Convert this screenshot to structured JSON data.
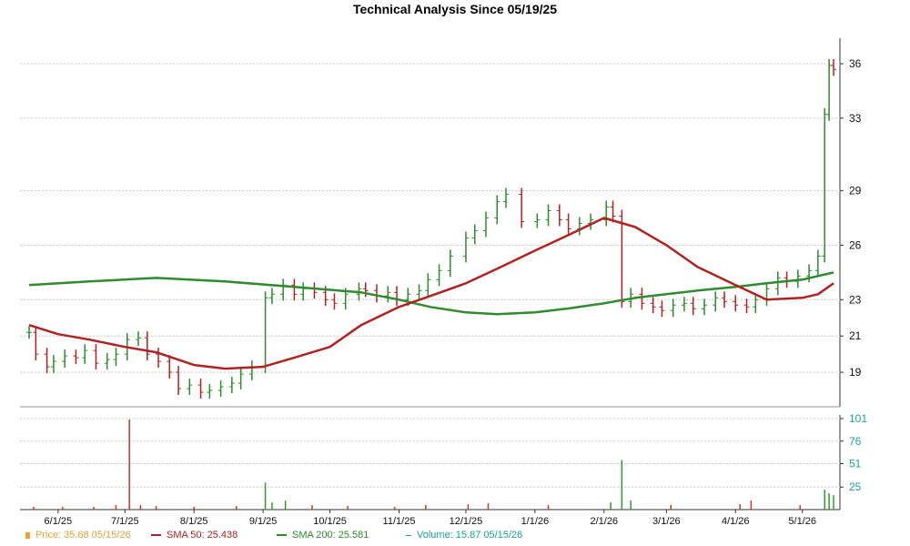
{
  "chart_data": {
    "type": "line",
    "title": "Technical Analysis Since 05/19/25",
    "price_axis": {
      "ticks": [
        19,
        21,
        23,
        26,
        29,
        33,
        36
      ],
      "ylim": [
        17.2,
        37.0
      ]
    },
    "volume_axis": {
      "ticks": [
        25,
        51,
        76,
        101
      ],
      "ylim": [
        0,
        101
      ]
    },
    "x_labels": [
      "6/1/25",
      "7/1/25",
      "8/1/25",
      "9/1/25",
      "10/1/25",
      "11/1/25",
      "12/1/25",
      "1/1/26",
      "2/1/26",
      "3/1/26",
      "4/1/26",
      "5/1/26"
    ],
    "x_label_dates": [
      "2025-06-01",
      "2025-07-01",
      "2025-08-01",
      "2025-09-01",
      "2025-10-01",
      "2025-11-01",
      "2025-12-01",
      "2026-01-01",
      "2026-02-01",
      "2026-03-01",
      "2026-04-01",
      "2026-05-01"
    ],
    "x_range": [
      "2025-05-19",
      "2026-05-15"
    ],
    "grid": true,
    "series": [
      {
        "name": "Price",
        "color": "#e8a33a",
        "values": [
          [
            "2025-05-19",
            21.2
          ],
          [
            "2025-05-22",
            20.0
          ],
          [
            "2025-05-27",
            19.3
          ],
          [
            "2025-05-30",
            19.6
          ],
          [
            "2025-06-04",
            19.9
          ],
          [
            "2025-06-09",
            19.8
          ],
          [
            "2025-06-13",
            20.2
          ],
          [
            "2025-06-18",
            19.5
          ],
          [
            "2025-06-23",
            19.7
          ],
          [
            "2025-06-27",
            20.0
          ],
          [
            "2025-07-02",
            20.8
          ],
          [
            "2025-07-07",
            20.9
          ],
          [
            "2025-07-11",
            20.0
          ],
          [
            "2025-07-16",
            19.6
          ],
          [
            "2025-07-21",
            19.0
          ],
          [
            "2025-07-25",
            18.1
          ],
          [
            "2025-07-30",
            18.3
          ],
          [
            "2025-08-04",
            17.9
          ],
          [
            "2025-08-08",
            18.0
          ],
          [
            "2025-08-13",
            18.2
          ],
          [
            "2025-08-18",
            18.4
          ],
          [
            "2025-08-22",
            18.9
          ],
          [
            "2025-08-27",
            19.3
          ],
          [
            "2025-09-02",
            23.1
          ],
          [
            "2025-09-05",
            23.3
          ],
          [
            "2025-09-10",
            23.8
          ],
          [
            "2025-09-15",
            23.3
          ],
          [
            "2025-09-19",
            23.6
          ],
          [
            "2025-09-24",
            23.4
          ],
          [
            "2025-09-29",
            23.0
          ],
          [
            "2025-10-03",
            22.8
          ],
          [
            "2025-10-08",
            23.3
          ],
          [
            "2025-10-14",
            23.6
          ],
          [
            "2025-10-17",
            23.5
          ],
          [
            "2025-10-22",
            23.2
          ],
          [
            "2025-10-27",
            23.4
          ],
          [
            "2025-10-31",
            23.0
          ],
          [
            "2025-11-05",
            23.3
          ],
          [
            "2025-11-10",
            23.5
          ],
          [
            "2025-11-14",
            24.1
          ],
          [
            "2025-11-19",
            24.6
          ],
          [
            "2025-11-24",
            25.4
          ],
          [
            "2025-12-01",
            26.4
          ],
          [
            "2025-12-05",
            26.8
          ],
          [
            "2025-12-10",
            27.5
          ],
          [
            "2025-12-15",
            28.4
          ],
          [
            "2025-12-19",
            28.8
          ],
          [
            "2025-12-26",
            27.3
          ],
          [
            "2026-01-02",
            27.4
          ],
          [
            "2026-01-07",
            27.9
          ],
          [
            "2026-01-12",
            27.4
          ],
          [
            "2026-01-16",
            26.9
          ],
          [
            "2026-01-21",
            27.2
          ],
          [
            "2026-01-26",
            27.4
          ],
          [
            "2026-02-02",
            28.1
          ],
          [
            "2026-02-05",
            27.6
          ],
          [
            "2026-02-09",
            22.9
          ],
          [
            "2026-02-13",
            23.3
          ],
          [
            "2026-02-18",
            22.8
          ],
          [
            "2026-02-23",
            22.6
          ],
          [
            "2026-02-27",
            22.4
          ],
          [
            "2026-03-04",
            22.7
          ],
          [
            "2026-03-09",
            22.8
          ],
          [
            "2026-03-13",
            22.5
          ],
          [
            "2026-03-18",
            22.7
          ],
          [
            "2026-03-23",
            23.1
          ],
          [
            "2026-03-27",
            22.9
          ],
          [
            "2026-04-01",
            22.7
          ],
          [
            "2026-04-06",
            22.6
          ],
          [
            "2026-04-10",
            23.0
          ],
          [
            "2026-04-15",
            23.6
          ],
          [
            "2026-04-20",
            24.2
          ],
          [
            "2026-04-24",
            24.0
          ],
          [
            "2026-04-29",
            24.3
          ],
          [
            "2026-05-04",
            24.6
          ],
          [
            "2026-05-08",
            25.4
          ],
          [
            "2026-05-11",
            33.2
          ],
          [
            "2026-05-13",
            35.9
          ],
          [
            "2026-05-15",
            35.68
          ]
        ]
      },
      {
        "name": "SMA 50",
        "color": "#b22222",
        "values": [
          [
            "2025-05-19",
            21.6
          ],
          [
            "2025-06-01",
            21.1
          ],
          [
            "2025-06-15",
            20.8
          ],
          [
            "2025-07-01",
            20.4
          ],
          [
            "2025-07-15",
            20.1
          ],
          [
            "2025-08-01",
            19.4
          ],
          [
            "2025-08-15",
            19.2
          ],
          [
            "2025-09-01",
            19.3
          ],
          [
            "2025-09-15",
            19.8
          ],
          [
            "2025-10-01",
            20.4
          ],
          [
            "2025-10-15",
            21.6
          ],
          [
            "2025-11-01",
            22.6
          ],
          [
            "2025-11-15",
            23.2
          ],
          [
            "2025-12-01",
            23.9
          ],
          [
            "2025-12-15",
            24.7
          ],
          [
            "2026-01-01",
            25.7
          ],
          [
            "2026-01-15",
            26.5
          ],
          [
            "2026-02-01",
            27.5
          ],
          [
            "2026-02-15",
            27.0
          ],
          [
            "2026-03-01",
            26.0
          ],
          [
            "2026-03-15",
            24.8
          ],
          [
            "2026-04-01",
            23.8
          ],
          [
            "2026-04-15",
            23.0
          ],
          [
            "2026-05-01",
            23.1
          ],
          [
            "2026-05-08",
            23.3
          ],
          [
            "2026-05-15",
            23.9
          ]
        ]
      },
      {
        "name": "SMA 200",
        "color": "#2e8b2e",
        "values": [
          [
            "2025-05-19",
            23.8
          ],
          [
            "2025-06-15",
            24.0
          ],
          [
            "2025-07-15",
            24.2
          ],
          [
            "2025-08-15",
            24.0
          ],
          [
            "2025-09-15",
            23.7
          ],
          [
            "2025-10-15",
            23.4
          ],
          [
            "2025-11-01",
            23.0
          ],
          [
            "2025-11-15",
            22.6
          ],
          [
            "2025-12-01",
            22.3
          ],
          [
            "2025-12-15",
            22.2
          ],
          [
            "2026-01-01",
            22.3
          ],
          [
            "2026-01-15",
            22.5
          ],
          [
            "2026-02-01",
            22.8
          ],
          [
            "2026-02-15",
            23.1
          ],
          [
            "2026-03-01",
            23.3
          ],
          [
            "2026-03-15",
            23.5
          ],
          [
            "2026-04-01",
            23.7
          ],
          [
            "2026-04-15",
            23.9
          ],
          [
            "2026-05-01",
            24.1
          ],
          [
            "2026-05-15",
            24.5
          ]
        ]
      },
      {
        "name": "Volume",
        "color": "#1aa39a",
        "values": [
          [
            "2025-05-21",
            3
          ],
          [
            "2025-06-03",
            3
          ],
          [
            "2025-06-17",
            3
          ],
          [
            "2025-06-27",
            5
          ],
          [
            "2025-07-03",
            100
          ],
          [
            "2025-07-08",
            5
          ],
          [
            "2025-07-15",
            4
          ],
          [
            "2025-08-01",
            3
          ],
          [
            "2025-08-20",
            4
          ],
          [
            "2025-09-02",
            30
          ],
          [
            "2025-09-05",
            8
          ],
          [
            "2025-09-11",
            10
          ],
          [
            "2025-09-23",
            5
          ],
          [
            "2025-10-09",
            4
          ],
          [
            "2025-10-30",
            3
          ],
          [
            "2025-11-13",
            5
          ],
          [
            "2025-12-02",
            6
          ],
          [
            "2025-12-11",
            7
          ],
          [
            "2026-01-07",
            5
          ],
          [
            "2026-02-04",
            8
          ],
          [
            "2026-02-09",
            55
          ],
          [
            "2026-02-13",
            10
          ],
          [
            "2026-03-03",
            5
          ],
          [
            "2026-04-03",
            6
          ],
          [
            "2026-04-08",
            10
          ],
          [
            "2026-04-30",
            5
          ],
          [
            "2026-05-11",
            22
          ],
          [
            "2026-05-13",
            18
          ],
          [
            "2026-05-15",
            15.87
          ]
        ]
      }
    ]
  },
  "legend": {
    "price": {
      "label": "Price: 35.68  05/15/26",
      "color": "#e8a33a"
    },
    "sma50": {
      "label": "SMA 50: 25.438",
      "color": "#b22222"
    },
    "sma200": {
      "label": "SMA 200: 25.581",
      "color": "#2e8b2e"
    },
    "volume": {
      "label": "Volume: 15.87  05/15/26",
      "color": "#1aa39a"
    }
  }
}
